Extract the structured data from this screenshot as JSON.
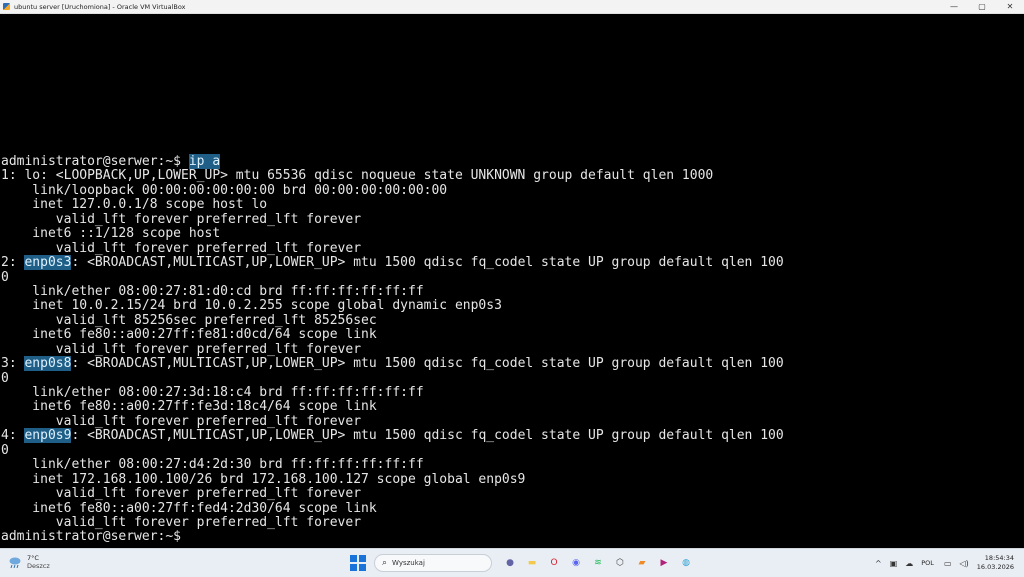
{
  "window": {
    "title": "ubuntu server [Uruchomiona] - Oracle VM VirtualBox",
    "controls": {
      "minimize": "—",
      "maximize": "▢",
      "close": "✕"
    }
  },
  "terminal": {
    "lines": [
      [
        {
          "t": "administrator@serwer:~$ "
        },
        {
          "t": "ip a",
          "hl": true
        }
      ],
      [
        {
          "t": "1: lo: <LOOPBACK,UP,LOWER_UP> mtu 65536 qdisc noqueue state UNKNOWN group default qlen 1000"
        }
      ],
      [
        {
          "t": "    link/loopback 00:00:00:00:00:00 brd 00:00:00:00:00:00"
        }
      ],
      [
        {
          "t": "    inet 127.0.0.1/8 scope host lo"
        }
      ],
      [
        {
          "t": "       valid_lft forever preferred_lft forever"
        }
      ],
      [
        {
          "t": "    inet6 ::1/128 scope host"
        }
      ],
      [
        {
          "t": "       valid_lft forever preferred_lft forever"
        }
      ],
      [
        {
          "t": "2: "
        },
        {
          "t": "enp0s3",
          "hl": true
        },
        {
          "t": ": <BROADCAST,MULTICAST,UP,LOWER_UP> mtu 1500 qdisc fq_codel state UP group default qlen 100"
        }
      ],
      [
        {
          "t": "0"
        }
      ],
      [
        {
          "t": "    link/ether 08:00:27:81:d0:cd brd ff:ff:ff:ff:ff:ff"
        }
      ],
      [
        {
          "t": "    inet 10.0.2.15/24 brd 10.0.2.255 scope global dynamic enp0s3"
        }
      ],
      [
        {
          "t": "       valid_lft 85256sec preferred_lft 85256sec"
        }
      ],
      [
        {
          "t": "    inet6 fe80::a00:27ff:fe81:d0cd/64 scope link"
        }
      ],
      [
        {
          "t": "       valid_lft forever preferred_lft forever"
        }
      ],
      [
        {
          "t": "3: "
        },
        {
          "t": "enp0s8",
          "hl": true
        },
        {
          "t": ": <BROADCAST,MULTICAST,UP,LOWER_UP> mtu 1500 qdisc fq_codel state UP group default qlen 100"
        }
      ],
      [
        {
          "t": "0"
        }
      ],
      [
        {
          "t": "    link/ether 08:00:27:3d:18:c4 brd ff:ff:ff:ff:ff:ff"
        }
      ],
      [
        {
          "t": "    inet6 fe80::a00:27ff:fe3d:18c4/64 scope link"
        }
      ],
      [
        {
          "t": "       valid_lft forever preferred_lft forever"
        }
      ],
      [
        {
          "t": "4: "
        },
        {
          "t": "enp0s9",
          "hl": true
        },
        {
          "t": ": <BROADCAST,MULTICAST,UP,LOWER_UP> mtu 1500 qdisc fq_codel state UP group default qlen 100"
        }
      ],
      [
        {
          "t": "0"
        }
      ],
      [
        {
          "t": "    link/ether 08:00:27:d4:2d:30 brd ff:ff:ff:ff:ff:ff"
        }
      ],
      [
        {
          "t": "    inet 172.168.100.100/26 brd 172.168.100.127 scope global enp0s9"
        }
      ],
      [
        {
          "t": "       valid_lft forever preferred_lft forever"
        }
      ],
      [
        {
          "t": "    inet6 fe80::a00:27ff:fed4:2d30/64 scope link"
        }
      ],
      [
        {
          "t": "       valid_lft forever preferred_lft forever"
        }
      ],
      [
        {
          "t": "administrator@serwer:~$ "
        }
      ]
    ]
  },
  "taskbar": {
    "weather": {
      "temp": "7°C",
      "condition": "Deszcz",
      "icon": "rain-cloud-icon"
    },
    "search_placeholder": "Wyszukaj",
    "apps": [
      {
        "name": "teams-icon",
        "color": "#6264a7",
        "glyph": "●"
      },
      {
        "name": "file-explorer-icon",
        "color": "#f2c94c",
        "glyph": "▬"
      },
      {
        "name": "opera-icon",
        "color": "#d5202f",
        "glyph": "O"
      },
      {
        "name": "discord-icon",
        "color": "#5865f2",
        "glyph": "◉"
      },
      {
        "name": "spotify-icon",
        "color": "#1db954",
        "glyph": "≋"
      },
      {
        "name": "virtualbox-icon",
        "color": "#444",
        "glyph": "⬡"
      },
      {
        "name": "sublime-icon",
        "color": "#f08a24",
        "glyph": "▰"
      },
      {
        "name": "media-player-icon",
        "color": "#b1227a",
        "glyph": "▶"
      },
      {
        "name": "browser-icon",
        "color": "#2b9fd6",
        "glyph": "◍"
      }
    ],
    "tray": {
      "chevron": "^",
      "language": "POL",
      "time": "18:54:34",
      "date": "16.03.2026"
    }
  },
  "colors": {
    "terminal_bg": "#000000",
    "terminal_fg": "#e6e6e6",
    "highlight_bg": "#1f5e86"
  }
}
